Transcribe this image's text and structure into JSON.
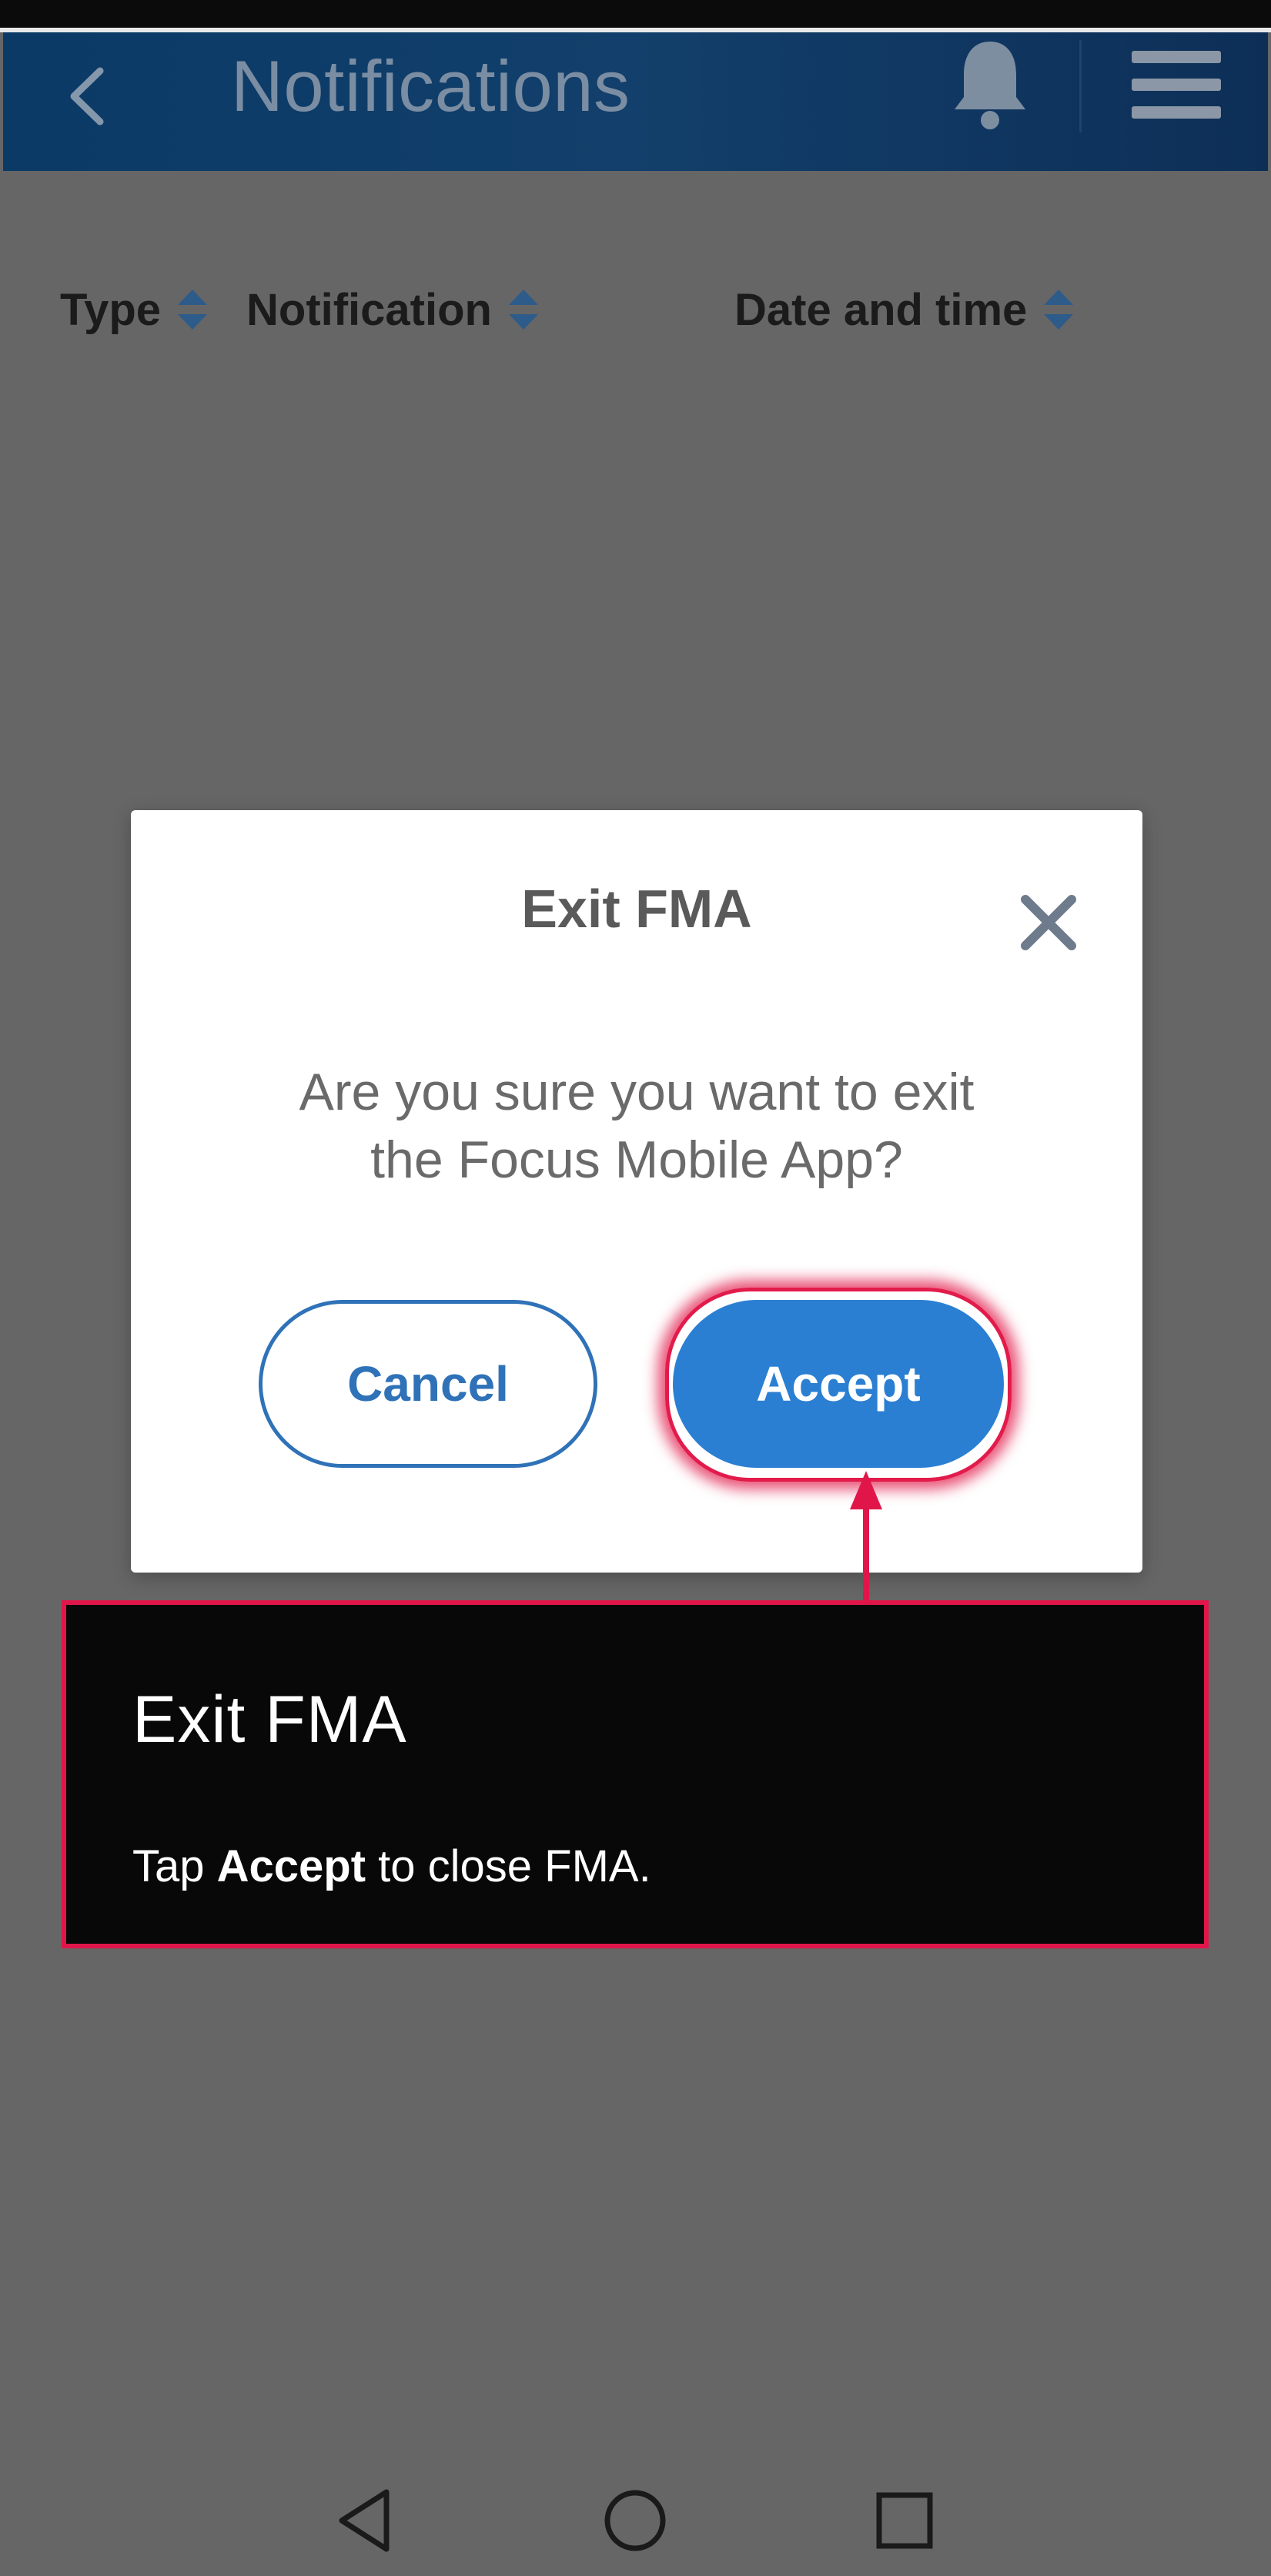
{
  "header": {
    "title": "Notifications"
  },
  "table": {
    "columns": [
      {
        "label": "Type"
      },
      {
        "label": "Notification"
      },
      {
        "label": "Date and time"
      }
    ]
  },
  "modal": {
    "title": "Exit FMA",
    "message_line1": "Are you sure you want to exit",
    "message_line2": "the Focus Mobile App?",
    "cancel_label": "Cancel",
    "accept_label": "Accept"
  },
  "tooltip": {
    "title": "Exit FMA",
    "text_prefix": "Tap ",
    "text_bold": "Accept",
    "text_suffix": " to close FMA."
  },
  "icons": {
    "back": "chevron-left-icon",
    "bell": "bell-icon",
    "menu": "hamburger-menu-icon",
    "sort": "sort-updown-icon",
    "close": "close-icon",
    "nav_back": "triangle-back-icon",
    "nav_home": "circle-home-icon",
    "nav_recent": "square-recent-icon"
  },
  "colors": {
    "accent": "#2b7fd2",
    "highlight": "#e0164a",
    "overlay": "#666666",
    "header": "#0b3a66"
  }
}
